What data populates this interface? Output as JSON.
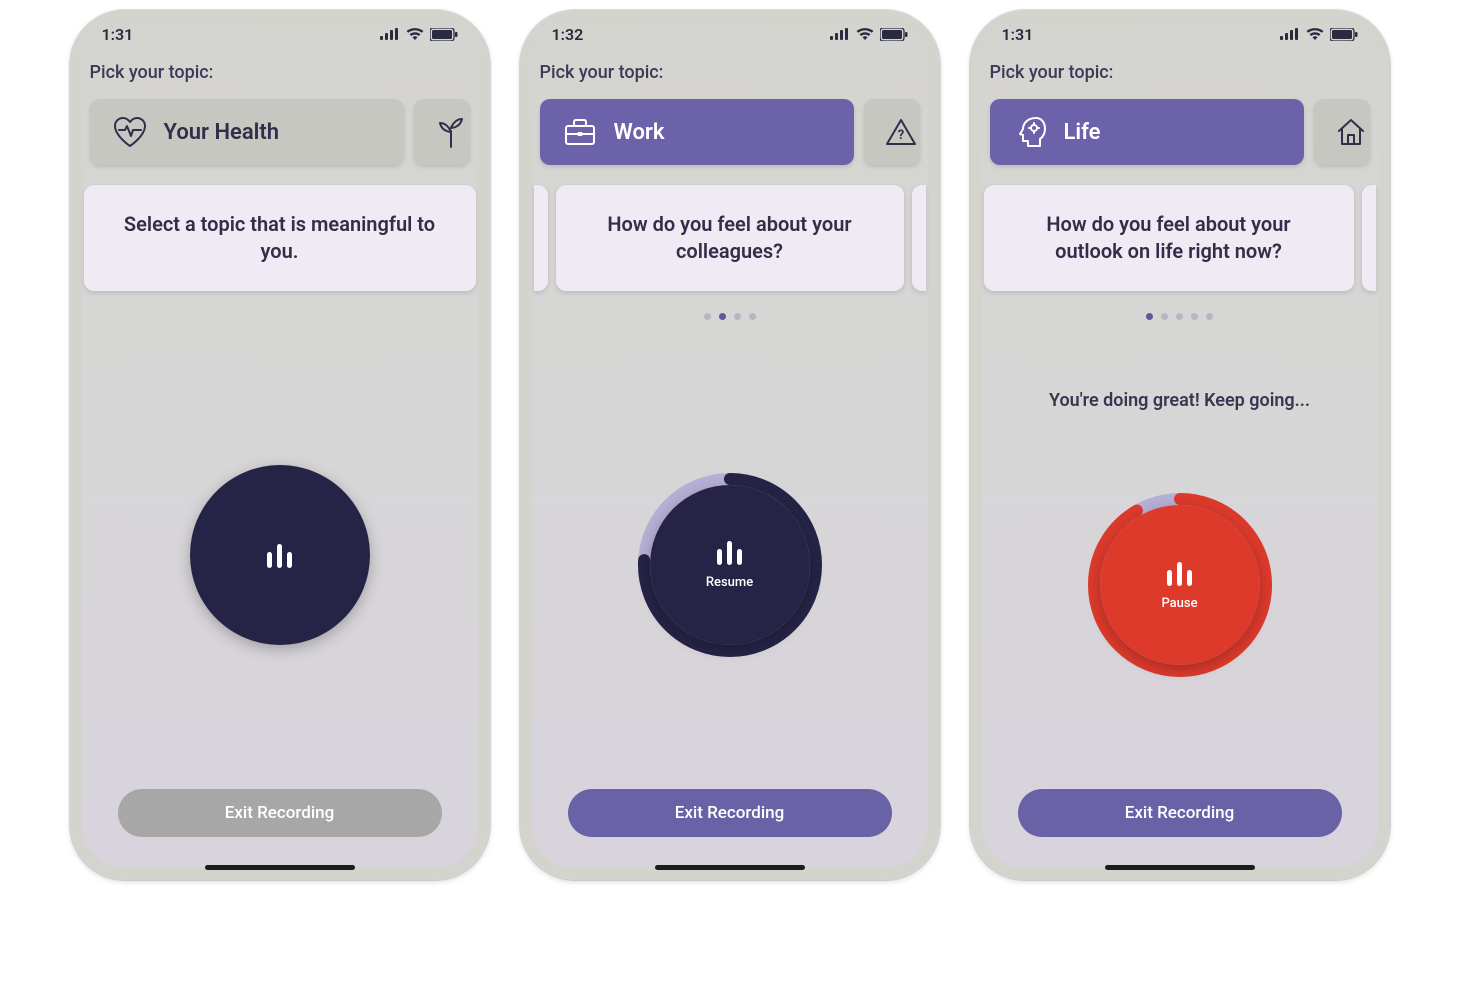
{
  "screens": [
    {
      "status_time": "1:31",
      "pick_label": "Pick your topic:",
      "main_topic": {
        "icon": "heart",
        "label": "Your Health",
        "active": false
      },
      "secondary_icon": "plant",
      "prompt": {
        "text": "Select a topic that is meaningful to you.",
        "side_left": false,
        "side_right": false
      },
      "dots": {
        "count": 0,
        "active": -1
      },
      "encourage": "",
      "record": {
        "color": "dark",
        "progress": 0,
        "label": "",
        "bars": "eq"
      },
      "exit": {
        "label": "Exit Recording",
        "style": "grey"
      }
    },
    {
      "status_time": "1:32",
      "pick_label": "Pick your topic:",
      "main_topic": {
        "icon": "briefcase",
        "label": "Work",
        "active": true
      },
      "secondary_icon": "warning",
      "prompt": {
        "text": "How do you feel about your colleagues?",
        "side_left": true,
        "side_right": true
      },
      "dots": {
        "count": 4,
        "active": 1
      },
      "encourage": "",
      "record": {
        "color": "dark",
        "progress": 76,
        "label": "Resume",
        "bars": "eq"
      },
      "exit": {
        "label": "Exit Recording",
        "style": "purple"
      }
    },
    {
      "status_time": "1:31",
      "pick_label": "Pick your topic:",
      "main_topic": {
        "icon": "head",
        "label": "Life",
        "active": true
      },
      "secondary_icon": "home",
      "prompt": {
        "text": "How do you feel about your outlook on life right now?",
        "side_left": false,
        "side_right": true
      },
      "dots": {
        "count": 5,
        "active": 0
      },
      "encourage": "You're doing great! Keep going...",
      "record": {
        "color": "red",
        "progress": 92,
        "label": "Pause",
        "bars": "pause"
      },
      "exit": {
        "label": "Exit Recording",
        "style": "purple"
      }
    }
  ]
}
